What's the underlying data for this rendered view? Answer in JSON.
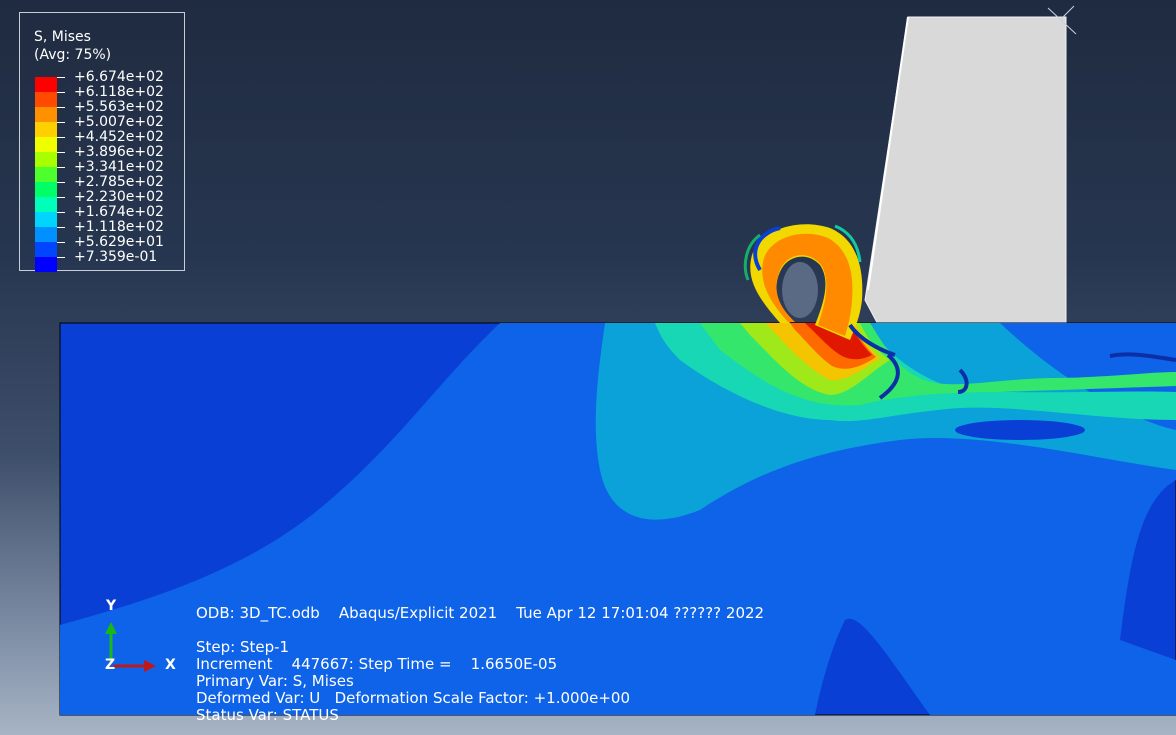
{
  "legend": {
    "title": "S, Mises",
    "subtitle": "(Avg: 75%)",
    "values": [
      "+6.674e+02",
      "+6.118e+02",
      "+5.563e+02",
      "+5.007e+02",
      "+4.452e+02",
      "+3.896e+02",
      "+3.341e+02",
      "+2.785e+02",
      "+2.230e+02",
      "+1.674e+02",
      "+1.118e+02",
      "+5.629e+01",
      "+7.359e-01"
    ],
    "colors": [
      "#ff0000",
      "#ff4a00",
      "#ff9000",
      "#ffcf00",
      "#f0ff00",
      "#a8ff00",
      "#4dff2d",
      "#00ff67",
      "#00ffb8",
      "#00d5ff",
      "#0090ff",
      "#0045ff",
      "#0000ff"
    ]
  },
  "triad": {
    "y_label": "Y",
    "z_label": "Z",
    "x_label": "X"
  },
  "info": {
    "odb_line": "ODB: 3D_TC.odb    Abaqus/Explicit 2021    Tue Apr 12 17:01:04 ?????? 2022",
    "step": "Step: Step-1",
    "increment": "Increment    447667: Step Time =    1.6650E-05",
    "primary_var": "Primary Var: S, Mises",
    "deformed_var": "Deformed Var: U   Deformation Scale Factor: +1.000e+00",
    "status_var": "Status Var: STATUS"
  },
  "colors": {
    "background_top": "#1f2b40",
    "background_bottom": "#a7b4c5",
    "tool": "#d7d7d7",
    "workpiece_dark": "#0a3fd6",
    "workpiece_mid": "#0e63e8"
  }
}
